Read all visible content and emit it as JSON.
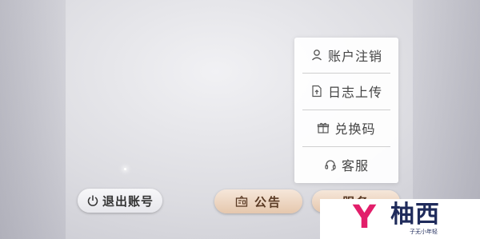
{
  "menu": {
    "items": [
      {
        "label": "账户注销",
        "icon": "user-icon"
      },
      {
        "label": "日志上传",
        "icon": "upload-document-icon"
      },
      {
        "label": "兑换码",
        "icon": "gift-icon"
      },
      {
        "label": "客服",
        "icon": "headset-icon"
      }
    ]
  },
  "bottom_bar": {
    "logout_label": "退出账号",
    "notice_label": "公告",
    "service_label": "服务"
  },
  "watermark": {
    "logo_letter": "Y",
    "brand": "柚西",
    "subtitle": "子无小年轻"
  },
  "colors": {
    "watermark_accent": "#e21e6a",
    "watermark_dark": "#1f2b5b",
    "gold_button": "#e5c7ad"
  }
}
